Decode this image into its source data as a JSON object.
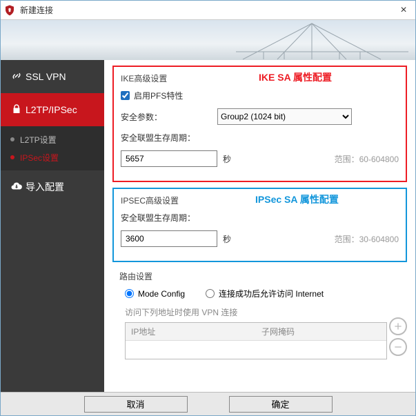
{
  "titlebar": {
    "title": "新建连接",
    "close": "×"
  },
  "sidebar": {
    "sslvpn": "SSL VPN",
    "l2tp": "L2TP/IPSec",
    "import": "导入配置",
    "sub_l2tp": "L2TP设置",
    "sub_ipsec": "IPSec设置"
  },
  "ike": {
    "group_title": "IKE高级设置",
    "annotation": "IKE SA 属性配置",
    "pfs_label": "启用PFS特性",
    "param_label": "安全参数：",
    "param_value": "Group2 (1024 bit)",
    "life_label": "安全联盟生存周期：",
    "life_value": "5657",
    "unit": "秒",
    "hint": "范围：60-604800"
  },
  "ipsec": {
    "group_title": "IPSEC高级设置",
    "annotation": "IPSec SA 属性配置",
    "life_label": "安全联盟生存周期：",
    "life_value": "3600",
    "unit": "秒",
    "hint": "范围：30-604800"
  },
  "route": {
    "group_title": "路由设置",
    "mode_config": "Mode Config",
    "allow_internet": "连接成功后允许访问 Internet",
    "vpn_label": "访问下列地址时使用 VPN 连接",
    "col_ip": "IP地址",
    "col_mask": "子网掩码"
  },
  "footer": {
    "cancel": "取消",
    "ok": "确定"
  }
}
